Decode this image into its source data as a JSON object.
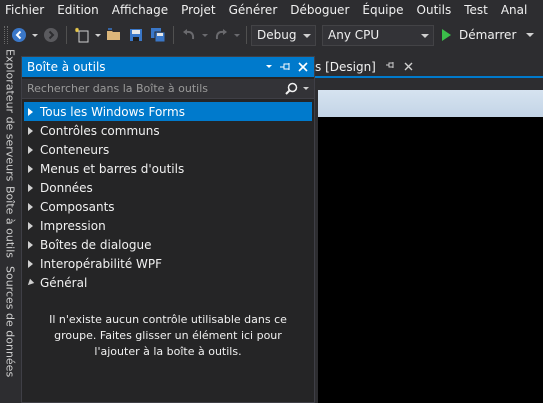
{
  "menu": [
    "Fichier",
    "Edition",
    "Affichage",
    "Projet",
    "Générer",
    "Déboguer",
    "Équipe",
    "Outils",
    "Test",
    "Anal"
  ],
  "toolbar": {
    "config": "Debug",
    "platform": "Any CPU",
    "start_label": "Démarrer",
    "icons": [
      "back-icon",
      "forward-icon",
      "new-project-icon",
      "open-folder-icon",
      "save-icon",
      "save-all-icon",
      "undo-icon",
      "redo-icon",
      "start-icon"
    ]
  },
  "side_tabs": [
    "Explorateur de serveurs",
    "Boîte à outils",
    "Sources de données"
  ],
  "toolbox": {
    "title": "Boîte à outils",
    "search_placeholder": "Rechercher dans la Boîte à outils",
    "categories": [
      {
        "label": "Tous les Windows Forms",
        "expanded": false,
        "selected": true
      },
      {
        "label": "Contrôles communs",
        "expanded": false,
        "selected": false
      },
      {
        "label": "Conteneurs",
        "expanded": false,
        "selected": false
      },
      {
        "label": "Menus et barres d'outils",
        "expanded": false,
        "selected": false
      },
      {
        "label": "Données",
        "expanded": false,
        "selected": false
      },
      {
        "label": "Composants",
        "expanded": false,
        "selected": false
      },
      {
        "label": "Impression",
        "expanded": false,
        "selected": false
      },
      {
        "label": "Boîtes de dialogue",
        "expanded": false,
        "selected": false
      },
      {
        "label": "Interopérabilité WPF",
        "expanded": false,
        "selected": false
      },
      {
        "label": "Général",
        "expanded": true,
        "selected": false
      }
    ],
    "empty_message": "Il n'existe aucun contrôle utilisable dans ce groupe. Faites glisser un élément ici pour l'ajouter à la boîte à outils."
  },
  "document_tab": {
    "label": "s [Design]"
  },
  "colors": {
    "accent": "#007acc",
    "background": "#2d2d30",
    "panel": "#252526",
    "start_green": "#3bbf4a"
  }
}
